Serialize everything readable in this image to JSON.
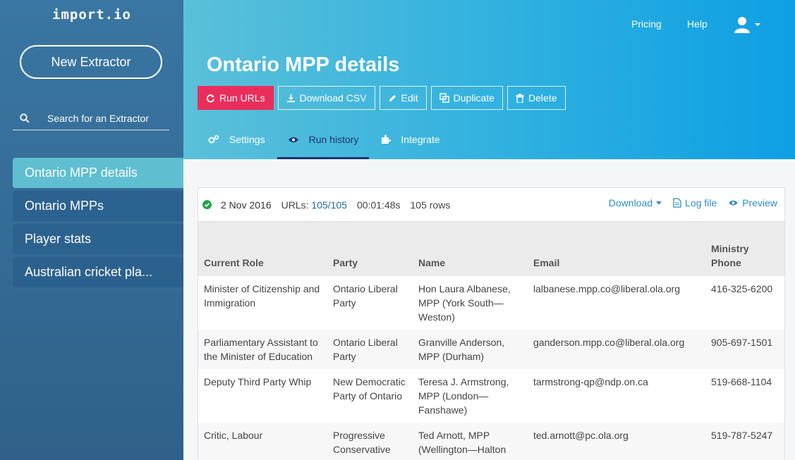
{
  "app": {
    "logo": "import.io"
  },
  "sidebar": {
    "new_button": "New Extractor",
    "search_placeholder": "Search for an Extractor",
    "items": [
      {
        "label": "Ontario MPP details",
        "active": true
      },
      {
        "label": "Ontario MPPs"
      },
      {
        "label": "Player stats"
      },
      {
        "label": "Australian cricket pla..."
      }
    ]
  },
  "topbar": {
    "pricing": "Pricing",
    "help": "Help"
  },
  "extractor": {
    "title": "Ontario MPP details",
    "actions": {
      "run": "Run URLs",
      "download_csv": "Download CSV",
      "edit": "Edit",
      "duplicate": "Duplicate",
      "delete": "Delete"
    },
    "tabs": {
      "settings": "Settings",
      "run_history": "Run history",
      "integrate": "Integrate"
    }
  },
  "run": {
    "date": "2 Nov 2016",
    "urls_label": "URLs:",
    "urls_value": "105/105",
    "duration": "00:01:48s",
    "rows": "105 rows",
    "download": "Download",
    "log_file": "Log file",
    "preview": "Preview"
  },
  "table": {
    "headers": [
      "Current Role",
      "Party",
      "Name",
      "Email",
      "Ministry Phone"
    ],
    "rows": [
      [
        "Minister of Citizenship and Immigration",
        "Ontario Liberal Party",
        "Hon Laura Albanese, MPP (York South—Weston)",
        "lalbanese.mpp.co@liberal.ola.org",
        "416-325-6200"
      ],
      [
        "Parliamentary Assistant to the Minister of Education",
        "Ontario Liberal Party",
        "Granville Anderson, MPP (Durham)",
        "ganderson.mpp.co@liberal.ola.org",
        "905-697-1501"
      ],
      [
        "Deputy Third Party Whip",
        "New Democratic Party of Ontario",
        "Teresa J. Armstrong, MPP (London—Fanshawe)",
        "tarmstrong-qp@ndp.on.ca",
        "519-668-1104"
      ],
      [
        "Critic, Labour",
        "Progressive Conservative Party of Ontario",
        "Ted Arnott, MPP (Wellington—Halton Hills)",
        "ted.arnott@pc.ola.org",
        "519-787-5247"
      ]
    ]
  },
  "colors": {
    "sidebar": "#2f6189",
    "active_item": "#5fbfd1",
    "header_start": "#5bc0d9",
    "header_end": "#0e9fe4",
    "primary_button": "#ea2e5c",
    "active_tab": "#1c3470",
    "success": "#27a34a",
    "link": "#2a8fc7"
  }
}
